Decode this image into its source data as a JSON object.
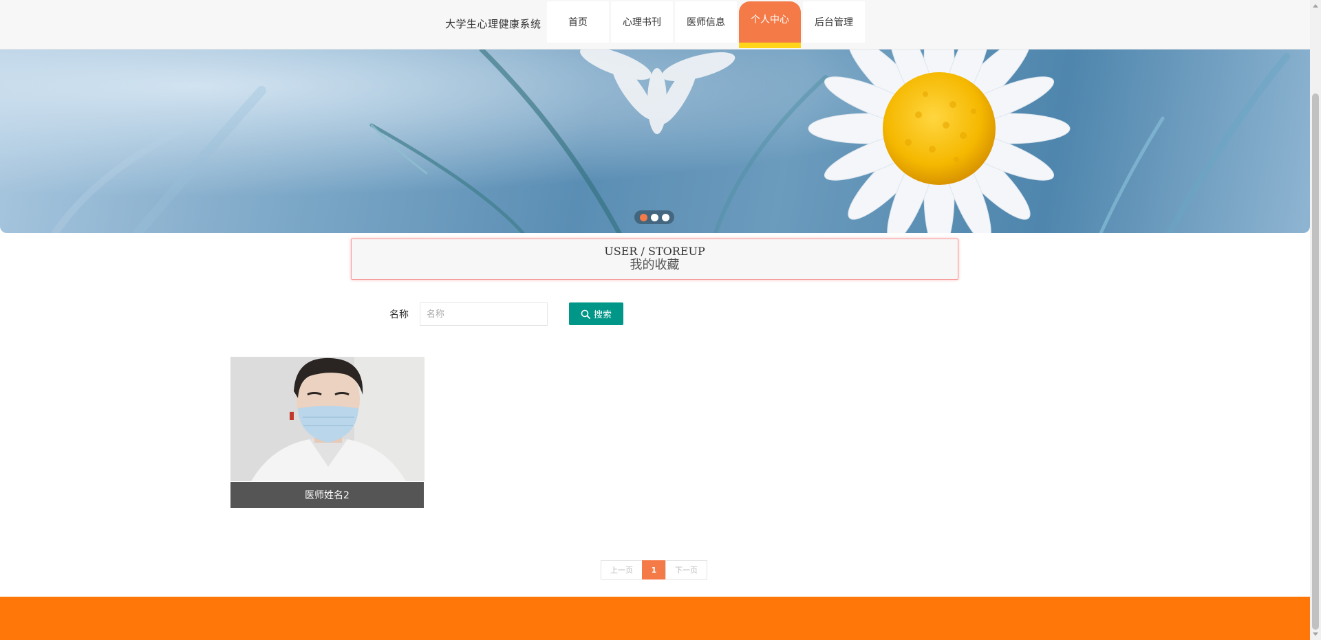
{
  "header": {
    "site_title": "大学生心理健康系统",
    "nav": [
      {
        "label": "首页",
        "active": false
      },
      {
        "label": "心理书刊",
        "active": false
      },
      {
        "label": "医师信息",
        "active": false
      },
      {
        "label": "个人中心",
        "active": true
      },
      {
        "label": "后台管理",
        "active": false
      }
    ]
  },
  "banner": {
    "slide_count": 3,
    "active_slide": 1
  },
  "section": {
    "title_en": "USER / STOREUP",
    "title_cn": "我的收藏"
  },
  "search": {
    "label": "名称",
    "placeholder": "名称",
    "value": "",
    "button_label": "搜索",
    "button_icon": "search-icon"
  },
  "items": [
    {
      "name": "医师姓名2"
    }
  ],
  "pagination": {
    "prev_label": "上一页",
    "current_page": "1",
    "next_label": "下一页"
  },
  "colors": {
    "accent": "#f47a47",
    "active_underline": "#ffd51a",
    "search_button": "#009688",
    "footer": "#ff7708",
    "card_label_bg": "#555555"
  }
}
